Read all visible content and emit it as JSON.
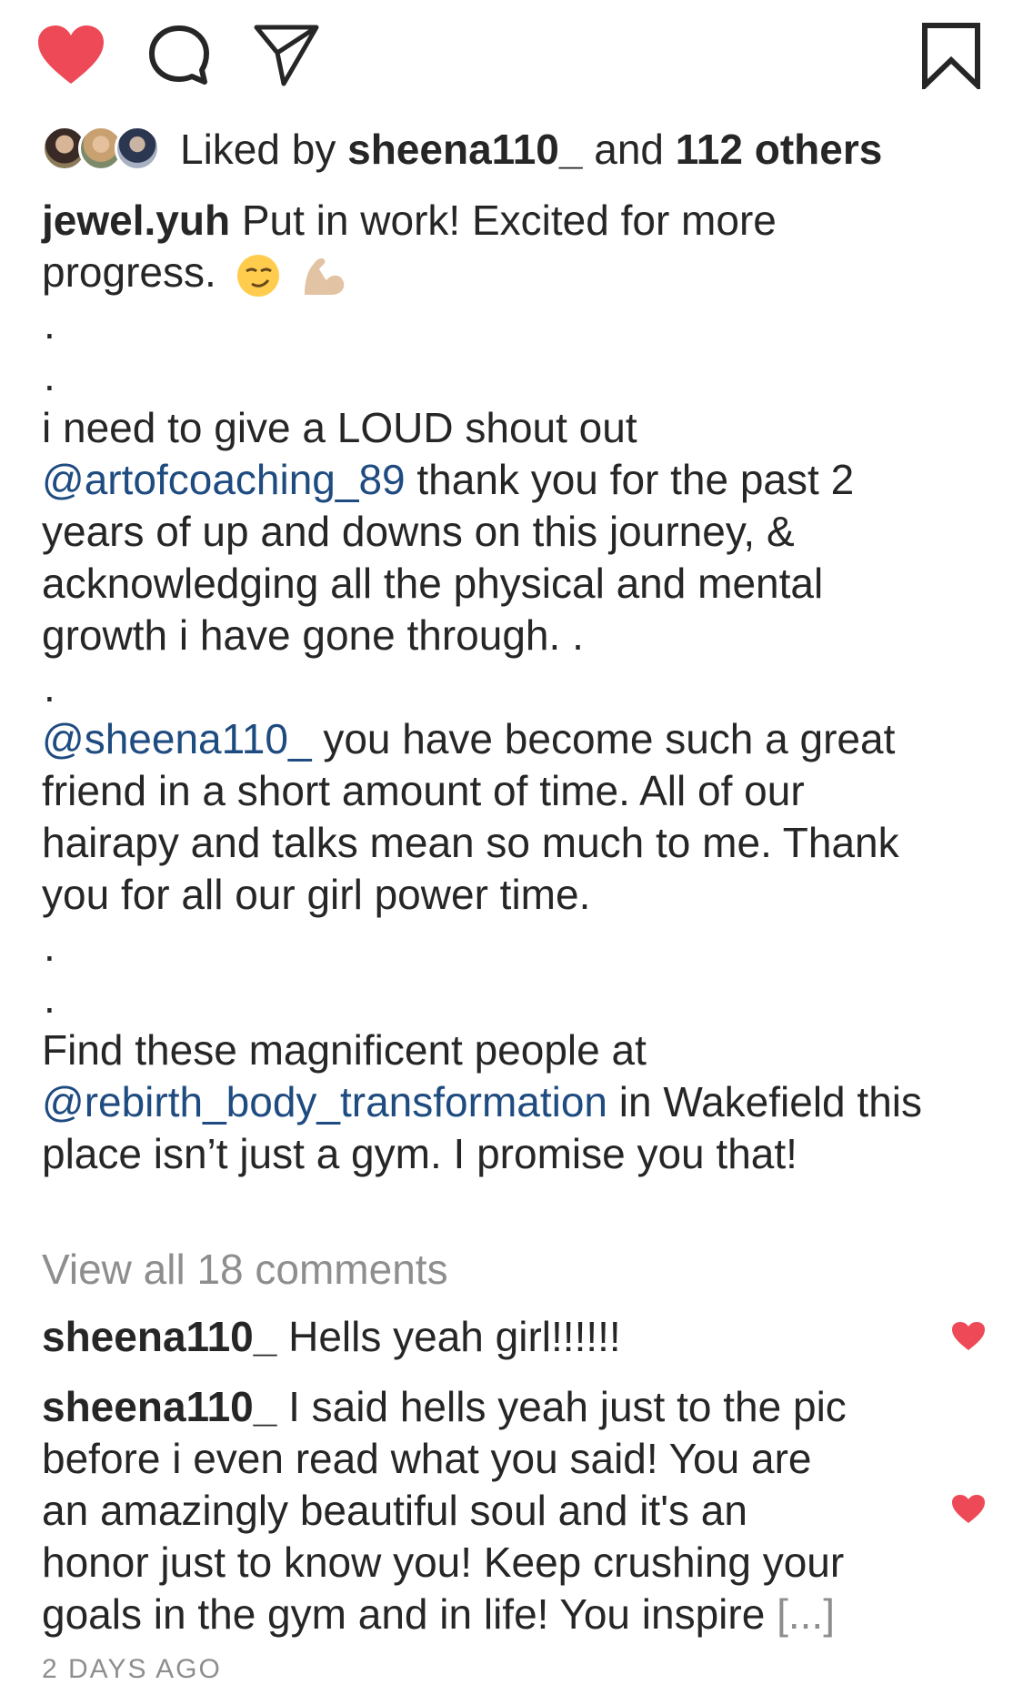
{
  "actions": {
    "like_icon": "heart-filled-icon",
    "comment_icon": "comment-bubble-icon",
    "share_icon": "paper-plane-icon",
    "save_icon": "bookmark-icon",
    "like_color": "#ed4956"
  },
  "likes": {
    "prefix": "Liked by",
    "user": "sheena110_",
    "middle": "and",
    "others": "112 others"
  },
  "caption": {
    "username": "jewel.yuh",
    "line1": "Put in work! Excited for more",
    "line2": "progress.",
    "dot": ".",
    "p2_line1": "i need to give a LOUD shout out",
    "p2_mention": "@artofcoaching_89",
    "p2_line2_rest": "thank you for the past 2",
    "p2_line3": "years of up and downs on this journey, &",
    "p2_line4": "acknowledging all the physical and mental",
    "p2_line5": "growth i have gone through. .",
    "p3_mention": "@sheena110_",
    "p3_line1_rest": "you have become such a great",
    "p3_line2": "friend in a short amount of time. All of our",
    "p3_line3": "hairapy and talks mean so much to me. Thank",
    "p3_line4": "you for all our girl power time.",
    "p4_line1": "Find these magnificent people at",
    "p4_mention": "@rebirth_body_transformation",
    "p4_line2_rest": "in Wakefield this",
    "p4_line3": "place isn’t just a gym. I promise you that!"
  },
  "view_all": "View all 18 comments",
  "comments": [
    {
      "user": "sheena110_",
      "text": "Hells yeah girl!!!!!!"
    },
    {
      "user": "sheena110_",
      "line1": "I said hells yeah just to the pic",
      "line2": "before i even read what you said!  You are",
      "line3": "an amazingly beautiful soul and it's an",
      "line4": "honor just to know you!  Keep crushing your",
      "line5": "goals in the gym and in life!  You inspire",
      "more": "[...]"
    }
  ],
  "timestamp": "2 DAYS AGO"
}
